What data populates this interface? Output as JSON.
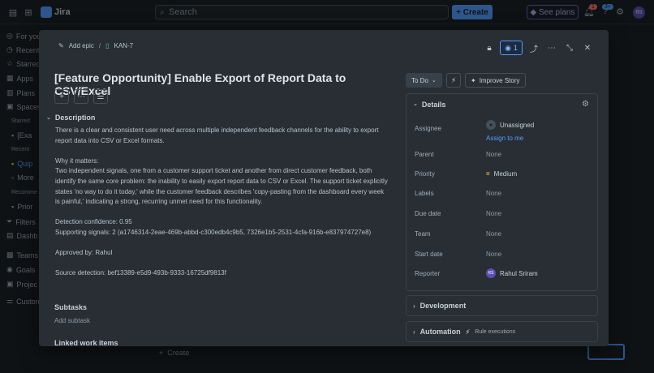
{
  "topbar": {
    "app_name": "Jira",
    "search_placeholder": "Search",
    "create_label": "Create",
    "see_plans_label": "See plans",
    "notif_badge": "1",
    "help_badge": "3+",
    "avatar_initials": "RS"
  },
  "sidebar": {
    "items": [
      "For you",
      "Recent",
      "Starred",
      "Apps",
      "Plans",
      "Spaces"
    ],
    "starred_head": "Starred",
    "starred_item": "[Exa",
    "recent_head": "Recent",
    "recent_item": "Quip",
    "more": "More",
    "recommended_head": "Recomme",
    "recommended_item": "Prior",
    "lower_items": [
      "Filters",
      "Dashb",
      "Teams",
      "Goals",
      "Projec",
      "Custom"
    ]
  },
  "background": {
    "create_label": "Create"
  },
  "modal": {
    "breadcrumb": {
      "add_epic": "Add epic",
      "sep": "/",
      "issue_key": "KAN-7"
    },
    "watch_count": "1",
    "title": "[Feature Opportunity] Enable Export of Report Data to CSV/Excel",
    "description": {
      "heading": "Description",
      "paragraphs": [
        "There is a clear and consistent user need across multiple independent feedback channels for the ability to export report data into CSV or Excel formats.",
        "Why it matters:\nTwo independent signals, one from a customer support ticket and another from direct customer feedback, both identify the same core problem: the inability to easily export report data to CSV or Excel. The support ticket explicitly states 'no way to do it today,' while the customer feedback describes 'copy-pasting from the dashboard every week is painful,' indicating a strong, recurring unmet need for this functionality.",
        "Detection confidence: 0.95\nSupporting signals: 2 (a1746314-2eae-469b-abbd-c300edb4c9b5, 7326e1b5-2531-4cfa-916b-e837974727e8)",
        "Approved by: Rahul",
        "Source detection: bef13389-e5d9-493b-9333-16725df9813f"
      ]
    },
    "subtasks": {
      "heading": "Subtasks",
      "add_label": "Add subtask"
    },
    "linked": {
      "heading": "Linked work items"
    },
    "status_label": "To Do",
    "improve_label": "Improve Story",
    "details": {
      "heading": "Details",
      "fields": {
        "assignee_label": "Assignee",
        "assignee_value": "Unassigned",
        "assign_me": "Assign to me",
        "parent_label": "Parent",
        "parent_value": "None",
        "priority_label": "Priority",
        "priority_value": "Medium",
        "labels_label": "Labels",
        "labels_value": "None",
        "due_label": "Due date",
        "due_value": "None",
        "team_label": "Team",
        "team_value": "None",
        "start_label": "Start date",
        "start_value": "None",
        "reporter_label": "Reporter",
        "reporter_value": "Rahul Sriram",
        "reporter_initials": "RS"
      }
    },
    "development_label": "Development",
    "automation_label": "Automation",
    "automation_sub": "Rule executions"
  }
}
